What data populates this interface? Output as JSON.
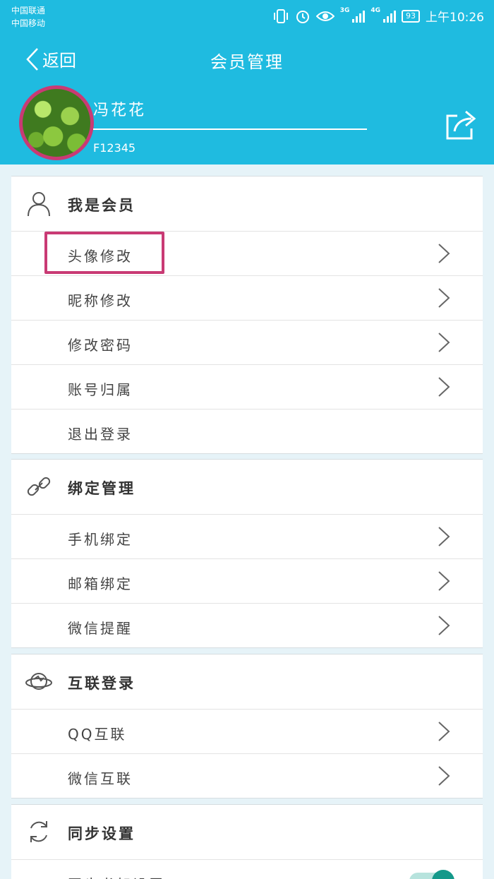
{
  "status_bar": {
    "carrier1": "中国联通",
    "carrier2": "中国移动",
    "network1": "3G",
    "network2": "4G",
    "battery": "93",
    "time": "上午10:26"
  },
  "header": {
    "back_label": "返回",
    "title": "会员管理",
    "username": "冯花花",
    "user_id": "F12345"
  },
  "sections": {
    "member": {
      "title": "我是会员",
      "items": [
        "头像修改",
        "昵称修改",
        "修改密码",
        "账号归属",
        "退出登录"
      ]
    },
    "binding": {
      "title": "绑定管理",
      "items": [
        "手机绑定",
        "邮箱绑定",
        "微信提醒"
      ]
    },
    "interconnect": {
      "title": "互联登录",
      "items": [
        "QQ互联",
        "微信互联"
      ]
    },
    "sync": {
      "title": "同步设置",
      "items": [
        "同步书架设置"
      ]
    }
  },
  "colors": {
    "header_bg": "#1fbbe0",
    "highlight": "#c93a74",
    "toggle": "#14998a"
  },
  "icons": [
    "vibrate-icon",
    "alarm-icon",
    "eye-icon",
    "back-chevron-icon",
    "share-icon",
    "user-icon",
    "link-icon",
    "planet-icon",
    "sync-icon",
    "chevron-right-icon"
  ]
}
